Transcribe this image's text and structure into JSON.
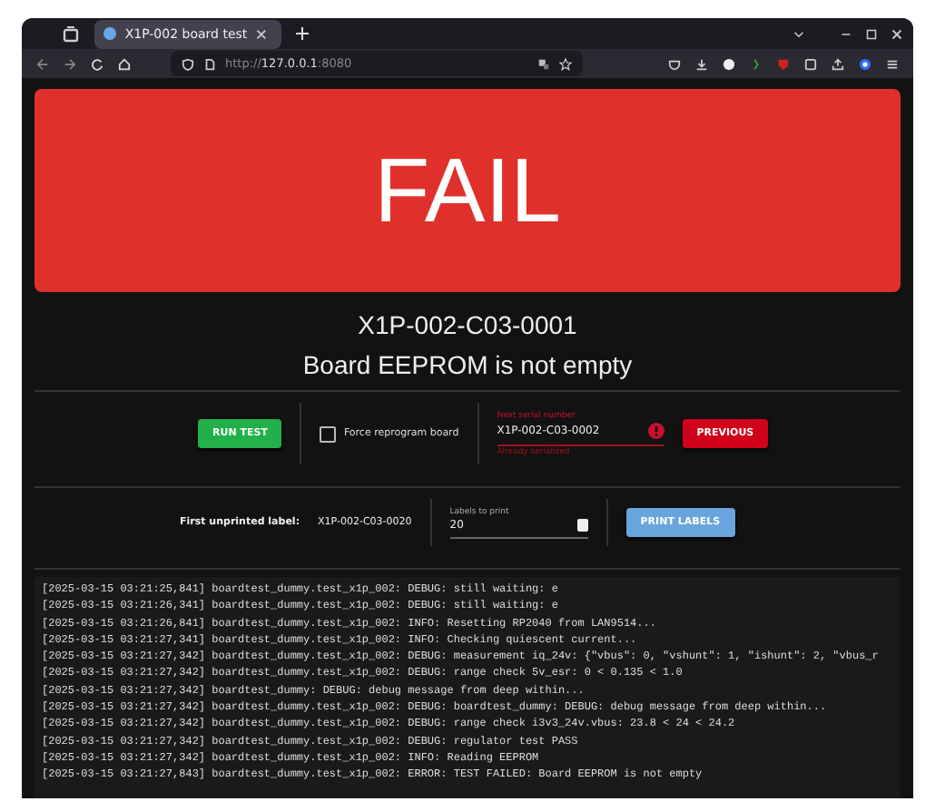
{
  "browser": {
    "tab_title": "X1P-002 board test",
    "url_prefix": "http://",
    "url_host": "127.0.0.1",
    "url_port": ":8080"
  },
  "result": {
    "text": "FAIL"
  },
  "serial": "X1P-002-C03-0001",
  "message": "Board EEPROM is not empty",
  "controls": {
    "run_button": "RUN TEST",
    "force_reprogram": {
      "label": "Force reprogram board",
      "checked": false
    },
    "next_serial": {
      "label": "Next serial number",
      "value": "X1P-002-C03-0002",
      "error": "Already serialized"
    },
    "previous_button": "PREVIOUS"
  },
  "labels": {
    "first_unprinted_label": "First unprinted label:",
    "first_unprinted_value": "X1P-002-C03-0020",
    "count_label": "Labels to print",
    "count_value": "20",
    "print_button": "PRINT LABELS"
  },
  "log": [
    "[2025-03-15 03:21:25,841] boardtest_dummy.test_x1p_002: DEBUG: still waiting: e",
    "[2025-03-15 03:21:26,341] boardtest_dummy.test_x1p_002: DEBUG: still waiting: e",
    "[2025-03-15 03:21:26,841] boardtest_dummy.test_x1p_002: INFO: Resetting RP2040 from LAN9514...",
    "[2025-03-15 03:21:27,341] boardtest_dummy.test_x1p_002: INFO: Checking quiescent current...",
    "[2025-03-15 03:21:27,342] boardtest_dummy.test_x1p_002: DEBUG: measurement iq_24v: {\"vbus\": 0, \"vshunt\": 1, \"ishunt\": 2, \"vbus_r",
    "[2025-03-15 03:21:27,342] boardtest_dummy.test_x1p_002: DEBUG: range check 5v_esr: 0 < 0.135 < 1.0",
    "[2025-03-15 03:21:27,342] boardtest_dummy: DEBUG: debug message from deep within...",
    "[2025-03-15 03:21:27,342] boardtest_dummy.test_x1p_002: DEBUG: boardtest_dummy: DEBUG: debug message from deep within...",
    "[2025-03-15 03:21:27,342] boardtest_dummy.test_x1p_002: DEBUG: range check i3v3_24v.vbus: 23.8 < 24 < 24.2",
    "[2025-03-15 03:21:27,342] boardtest_dummy.test_x1p_002: DEBUG: regulator test PASS",
    "[2025-03-15 03:21:27,342] boardtest_dummy.test_x1p_002: INFO: Reading EEPROM",
    "[2025-03-15 03:21:27,843] boardtest_dummy.test_x1p_002: ERROR: TEST FAILED: Board EEPROM is not empty"
  ]
}
